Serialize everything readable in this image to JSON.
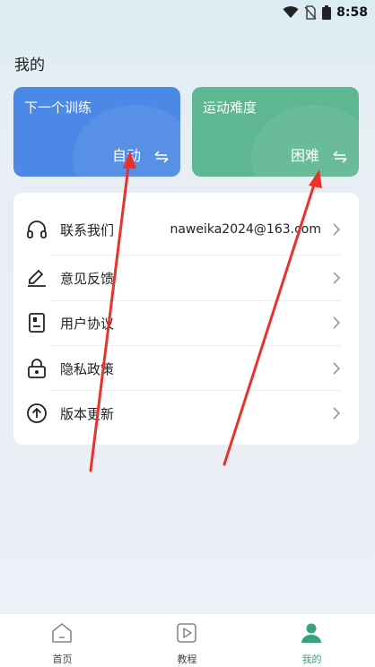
{
  "status_bar": {
    "time": "8:58"
  },
  "page": {
    "title": "我的"
  },
  "cards": {
    "train": {
      "title": "下一个训练",
      "value": "自动"
    },
    "difficulty": {
      "title": "运动难度",
      "value": "困难"
    }
  },
  "menu": {
    "contact": {
      "label": "联系我们",
      "value": "naweika2024@163.com"
    },
    "feedback": {
      "label": "意见反馈"
    },
    "agreement": {
      "label": "用户协议"
    },
    "privacy": {
      "label": "隐私政策"
    },
    "update": {
      "label": "版本更新"
    }
  },
  "nav": {
    "home": "首页",
    "tutorial": "教程",
    "mine": "我的"
  },
  "colors": {
    "train_card": "#4c88e5",
    "difficulty_card": "#5fb693",
    "nav_active": "#3aa37e",
    "annotation_arrow": "#e8322a"
  }
}
